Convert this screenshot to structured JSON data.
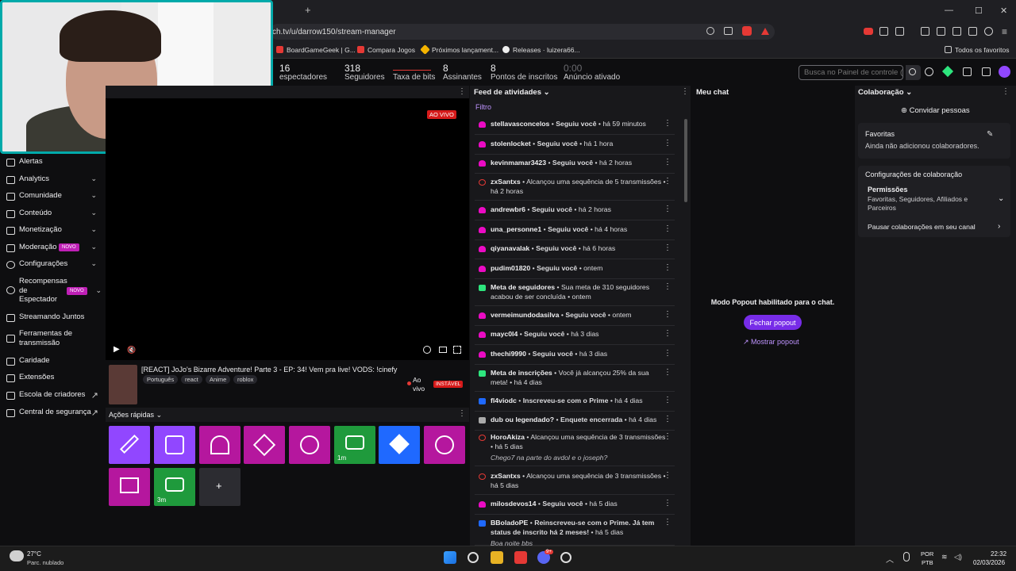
{
  "browser": {
    "url": "ch.tv/u/darrow150/stream-manager",
    "new_tab": "+",
    "bookmarks": [
      {
        "label": "BoardGameGeek | G...",
        "color": "#e53935"
      },
      {
        "label": "Compara Jogos",
        "color": "#e53935"
      },
      {
        "label": "Próximos lançament...",
        "color": "#f5b400"
      },
      {
        "label": "Releases · luizera66...",
        "color": "#eeeeee"
      }
    ],
    "all_favorites": "Todos os favoritos",
    "window": {
      "min": "—",
      "max": "☐",
      "close": "✕"
    }
  },
  "stats": [
    {
      "value": "16",
      "label": "espectadores"
    },
    {
      "value": "318",
      "label": "Seguidores"
    },
    {
      "value": "",
      "label": "Taxa de bits"
    },
    {
      "value": "8",
      "label": "Assinantes"
    },
    {
      "value": "8",
      "label": "Pontos de inscritos"
    },
    {
      "value": "0:00",
      "label": "Anúncio ativado"
    }
  ],
  "search": {
    "placeholder": "Busca no Painel de controle (/"
  },
  "sidebar": {
    "items": [
      {
        "label": "Alertas",
        "chevron": ""
      },
      {
        "label": "Analytics",
        "chevron": "⌄"
      },
      {
        "label": "Comunidade",
        "chevron": "⌄"
      },
      {
        "label": "Conteúdo",
        "chevron": "⌄"
      },
      {
        "label": "Monetização",
        "chevron": "⌄"
      },
      {
        "label": "Moderação",
        "chevron": "⌄",
        "badge": "NOVO"
      },
      {
        "label": "Configurações",
        "chevron": "⌄"
      },
      {
        "label": "Recompensas de Espectador",
        "chevron": "⌄",
        "badge": "NOVO"
      },
      {
        "label": "Streamando Juntos",
        "chevron": ""
      },
      {
        "label": "Ferramentas de transmissão",
        "chevron": ""
      },
      {
        "label": "Caridade",
        "chevron": ""
      },
      {
        "label": "Extensões",
        "chevron": ""
      },
      {
        "label": "Escola de criadores",
        "chevron": "↗"
      },
      {
        "label": "Central de segurança",
        "chevron": "↗"
      }
    ]
  },
  "player": {
    "live_badge": "AO VIVO",
    "play": "▶",
    "mute": "🔇",
    "title": "[REACT] JoJo's Bizarre Adventure! Parte 3 - EP: 34! Vem pra live! VODS: !cinefy",
    "tags": [
      "Português",
      "react",
      "Anime",
      "roblox"
    ],
    "status": "Ao vivo",
    "stability": "INSTÁVEL"
  },
  "quick_actions": {
    "title": "Ações rápidas",
    "tiles": [
      {
        "color": "#9147ff",
        "label": ""
      },
      {
        "color": "#9147ff",
        "label": ""
      },
      {
        "color": "#b5179e",
        "label": ""
      },
      {
        "color": "#b5179e",
        "label": ""
      },
      {
        "color": "#b5179e",
        "label": ""
      },
      {
        "color": "#1f9a3c",
        "label": "1m"
      },
      {
        "color": "#1f69ff",
        "label": ""
      },
      {
        "color": "#b5179e",
        "label": ""
      },
      {
        "color": "#b5179e",
        "label": ""
      },
      {
        "color": "#1f9a3c",
        "label": "3m"
      },
      {
        "color": "#2c2c31",
        "label": "+"
      }
    ]
  },
  "feed": {
    "title": "Feed de atividades",
    "filter": "Filtro",
    "items": [
      {
        "user": "stellavasconcelos",
        "action": "Seguiu você",
        "time": "há 59 minutos",
        "type": "follow"
      },
      {
        "user": "stolenlocket",
        "action": "Seguiu você",
        "time": "há 1 hora",
        "type": "follow"
      },
      {
        "user": "kevinmamar3423",
        "action": "Seguiu você",
        "time": "há 2 horas",
        "type": "follow"
      },
      {
        "user": "zxSantxs",
        "action": "Alcançou uma sequência de 5 transmissões",
        "time": "há 2 horas",
        "type": "streak"
      },
      {
        "user": "andrewbr6",
        "action": "Seguiu você",
        "time": "há 2 horas",
        "type": "follow"
      },
      {
        "user": "una_personne1",
        "action": "Seguiu você",
        "time": "há 4 horas",
        "type": "follow"
      },
      {
        "user": "qiyanavalak",
        "action": "Seguiu você",
        "time": "há 6 horas",
        "type": "follow"
      },
      {
        "user": "pudim01820",
        "action": "Seguiu você",
        "time": "ontem",
        "type": "follow"
      },
      {
        "user": "Meta de seguidores",
        "action": "Sua meta de 310 seguidores acabou de ser concluída",
        "time": "ontem",
        "type": "goal"
      },
      {
        "user": "vermeimundodasilva",
        "action": "Seguiu você",
        "time": "ontem",
        "type": "follow"
      },
      {
        "user": "mayc0l4",
        "action": "Seguiu você",
        "time": "há 3 dias",
        "type": "follow"
      },
      {
        "user": "thechi9990",
        "action": "Seguiu você",
        "time": "há 3 dias",
        "type": "follow"
      },
      {
        "user": "Meta de inscrições",
        "action": "Você já alcançou 25% da sua meta!",
        "time": "há 4 dias",
        "type": "goal"
      },
      {
        "user": "fl4viodc",
        "action": "Inscreveu-se com o Prime",
        "time": "há 4 dias",
        "type": "prime"
      },
      {
        "user": "dub ou legendado?",
        "action": "Enquete encerrada",
        "time": "há 4 dias",
        "type": "poll"
      },
      {
        "user": "HoroAkiza",
        "action": "Alcançou uma sequência de 3 transmissões",
        "time": "há 5 dias",
        "type": "streak",
        "message": "Chego7 na parte do avdol e o joseph?"
      },
      {
        "user": "zxSantxs",
        "action": "Alcançou uma sequência de 3 transmissões",
        "time": "há 5 dias",
        "type": "streak"
      },
      {
        "user": "milosdevos14",
        "action": "Seguiu você",
        "time": "há 5 dias",
        "type": "follow"
      },
      {
        "user": "BBoladoPE",
        "action": "Reinscreveu-se com o Prime. Já tem status de inscrito há 2 meses!",
        "time": "há 5 dias",
        "type": "prime",
        "message": "Boa noite bbs"
      }
    ]
  },
  "chat": {
    "title": "Meu chat",
    "popout_message": "Modo Popout habilitado para o chat.",
    "close_popout": "Fechar popout",
    "show_popout": "Mostrar popout"
  },
  "collab": {
    "title": "Colaboração",
    "invite": "Convidar pessoas",
    "favorites_title": "Favoritas",
    "favorites_empty": "Ainda não adicionou colaboradores.",
    "settings_title": "Configurações de colaboração",
    "permissions_title": "Permissões",
    "permissions_value": "Favoritas, Seguidores, Afiliados e Parceiros",
    "pause": "Pausar colaborações em seu canal"
  },
  "taskbar": {
    "weather_temp": "27°C",
    "weather_desc": "Parc. nublado",
    "lang": "POR",
    "lang2": "PTB",
    "time": "22:32",
    "date": "02/03/2026",
    "discord_badge": "9+"
  }
}
